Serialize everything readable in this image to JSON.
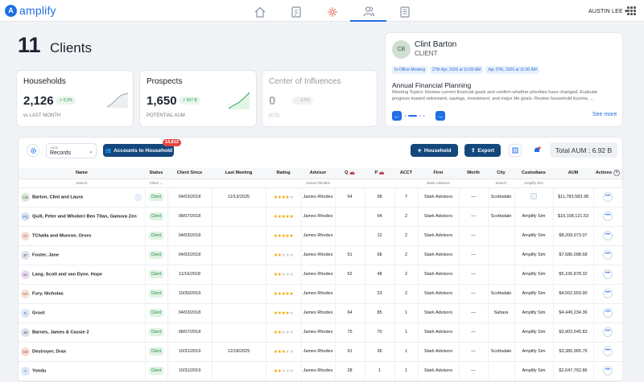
{
  "brand": {
    "name": "amplify",
    "mark": "A"
  },
  "nav": {
    "icons": [
      "home-icon",
      "document-dollar-icon",
      "flower-icon",
      "users-icon",
      "report-icon"
    ],
    "active": "users-icon"
  },
  "user": {
    "name": "AUSTIN LEE",
    "caret": "▾"
  },
  "page": {
    "count": "11",
    "title": "Clients"
  },
  "households": {
    "title": "Households",
    "value": "2,126",
    "change": "0.2%",
    "sub": "vs LAST MONTH"
  },
  "prospects": {
    "title": "Prospects",
    "value": "1,650",
    "change": "507 B",
    "sub": "POTENTIAL AUM"
  },
  "coi": {
    "title": "Center of Influences",
    "value": "0",
    "change": "0.0%",
    "sub": "(CO)"
  },
  "profile": {
    "initials": "CB",
    "name": "Clint Barton",
    "role": "CLIENT",
    "tags": [
      "In-Office Meeting",
      "27th Apr, 2026 at 10:00 AM",
      "Apr 27th, 2026 at 11:00 AM"
    ],
    "meeting_title": "Annual Financial Planning",
    "meeting_desc": "Meeting Topics: Review current financial goals and confirm whether priorities have changed. Evaluate progress toward retirement, savings, investment, and major life goals. Review household income, ...",
    "see_more": "See more"
  },
  "toolbar": {
    "view_label": "VIEW",
    "view_value": "Records",
    "accounts_btn": "Accounts to Household",
    "accounts_badge": "14,812",
    "household_btn": "Household",
    "export_btn": "Export",
    "total_aum": "Total AUM : 6.92 B"
  },
  "table": {
    "headers": [
      "Name",
      "Status",
      "Client Since",
      "Last Meeting",
      "Rating",
      "Advisor",
      "Q",
      "P",
      "ACCT",
      "Firm",
      "Worth",
      "City",
      "Custodians",
      "AUM",
      "Actions"
    ],
    "search": {
      "name": "Search",
      "status": "Client",
      "advisor": "James Rhodes",
      "firm": "Stark Advisors",
      "city": "Search",
      "custodians": "Amplify Sim"
    },
    "colors": {
      "accent": "#1f6fe5",
      "button": "#14477c",
      "status": "#dff3e4",
      "star": "#f0a800"
    },
    "rows": [
      {
        "initials": "CB",
        "bg": "#dbe7dc",
        "fg": "#3d6a45",
        "name": "Barton, Clint and Laura",
        "status": "Client",
        "since": "04/03/2018",
        "last": "11/13/2025",
        "rating": 4,
        "advisor": "James Rhodes",
        "q": "54",
        "p": "58",
        "acct": "7",
        "firm": "Stark Advisors",
        "worth": "—",
        "city": "Scottsdale",
        "cust": "icon",
        "aum": "$11,783,583.38"
      },
      {
        "initials": "PQ",
        "bg": "#dbe6f7",
        "fg": "#3a5f9a",
        "name": "Quill, Peter and Whoberi Ben Titan, Gamora Zen",
        "status": "Client",
        "since": "08/07/2018",
        "last": "",
        "rating": 5,
        "advisor": "James Rhodes",
        "q": "",
        "p": "64",
        "acct": "2",
        "firm": "Stark Advisors",
        "worth": "—",
        "city": "Scottsdale",
        "cust": "Amplify Sim",
        "aum": "$10,108,121.53"
      },
      {
        "initials": "AT",
        "bg": "#f7dcd8",
        "fg": "#a2483c",
        "name": "TChalla and Munroe, Ororo",
        "status": "Client",
        "since": "04/03/2018",
        "last": "",
        "rating": 5,
        "advisor": "James Rhodes",
        "q": "",
        "p": "12",
        "acct": "2",
        "firm": "Stark Advisors",
        "worth": "—",
        "city": "",
        "cust": "Amplify Sim",
        "aum": "$8,209,073.07"
      },
      {
        "initials": "JF",
        "bg": "#dde2ea",
        "fg": "#4a5568",
        "name": "Foster, Jane",
        "status": "Client",
        "since": "04/02/2018",
        "last": "",
        "rating": 2,
        "advisor": "James Rhodes",
        "q": "51",
        "p": "68",
        "acct": "2",
        "firm": "Stark Advisors",
        "worth": "—",
        "city": "",
        "cust": "Amplify Sim",
        "aum": "$7,586,098.68"
      },
      {
        "initials": "SL",
        "bg": "#e5dcef",
        "fg": "#6a4b8e",
        "name": "Lang, Scott and van Dyne, Hope",
        "status": "Client",
        "since": "11/16/2018",
        "last": "",
        "rating": 2,
        "advisor": "James Rhodes",
        "q": "62",
        "p": "48",
        "acct": "2",
        "firm": "Stark Advisors",
        "worth": "—",
        "city": "",
        "cust": "Amplify Sim",
        "aum": "$5,106,878.32"
      },
      {
        "initials": "NF",
        "bg": "#f7e2d3",
        "fg": "#a0603a",
        "name": "Fury, Nicholas",
        "status": "Client",
        "since": "10/30/2019",
        "last": "",
        "rating": 5,
        "advisor": "James Rhodes",
        "q": "",
        "p": "23",
        "acct": "2",
        "firm": "Stark Advisors",
        "worth": "—",
        "city": "Scottsdale",
        "cust": "Amplify Sim",
        "aum": "$4,552,659.90"
      },
      {
        "initials": "G",
        "bg": "#dbe6f7",
        "fg": "#3a5f9a",
        "name": "Groot",
        "status": "Client",
        "since": "04/03/2018",
        "last": "",
        "rating": 4,
        "advisor": "James Rhodes",
        "q": "64",
        "p": "85",
        "acct": "1",
        "firm": "Stark Advisors",
        "worth": "—",
        "city": "Sahara",
        "cust": "Amplify Sim",
        "aum": "$4,449,234.36"
      },
      {
        "initials": "JB",
        "bg": "#dde2ea",
        "fg": "#4a5568",
        "name": "Barnes, James & Cassie 2",
        "status": "Client",
        "since": "08/07/2018",
        "last": "",
        "rating": 2,
        "advisor": "James Rhodes",
        "q": "75",
        "p": "70",
        "acct": "1",
        "firm": "Stark Advisors",
        "worth": "—",
        "city": "",
        "cust": "Amplify Sim",
        "aum": "$3,903,545.83"
      },
      {
        "initials": "DD",
        "bg": "#f7dcd8",
        "fg": "#a2483c",
        "name": "Destroyer, Drax",
        "status": "Client",
        "since": "10/31/2019",
        "last": "12/18/2025",
        "rating": 3,
        "advisor": "James Rhodes",
        "q": "91",
        "p": "36",
        "acct": "1",
        "firm": "Stark Advisors",
        "worth": "—",
        "city": "Scottsdale",
        "cust": "Amplify Sim",
        "aum": "$3,385,965.76"
      },
      {
        "initials": "Y",
        "bg": "#dbe6f7",
        "fg": "#3a5f9a",
        "name": "Yondu",
        "status": "Client",
        "since": "10/31/2019",
        "last": "",
        "rating": 2,
        "advisor": "James Rhodes",
        "q": "28",
        "p": "1",
        "acct": "1",
        "firm": "Stark Advisors",
        "worth": "—",
        "city": "",
        "cust": "Amplify Sim",
        "aum": "$2,647,762.86"
      }
    ]
  }
}
